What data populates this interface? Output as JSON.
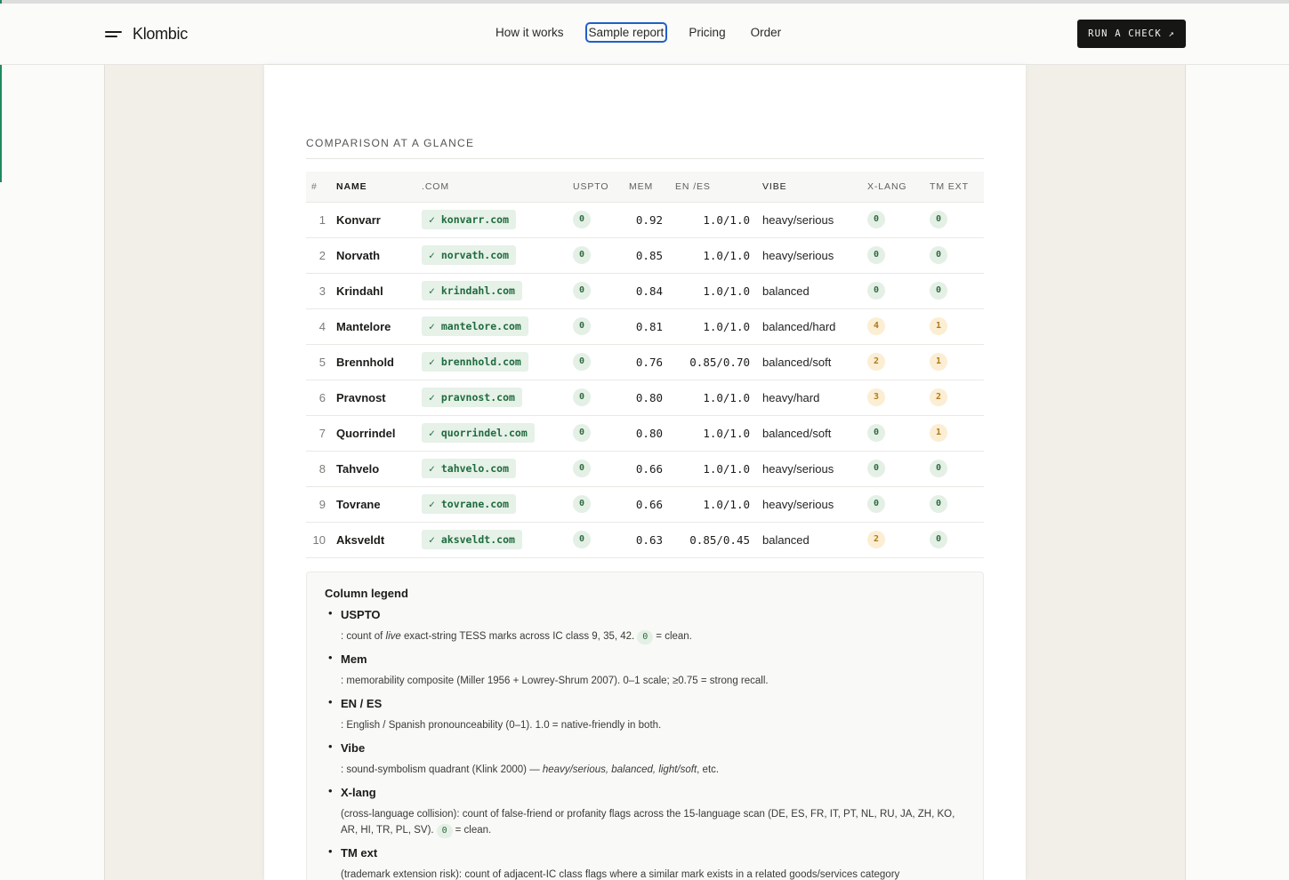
{
  "header": {
    "brand": "Klombic",
    "nav": [
      {
        "label": "How it works"
      },
      {
        "label": "Sample report"
      },
      {
        "label": "Pricing"
      },
      {
        "label": "Order"
      }
    ],
    "cta_label": "RUN A CHECK ↗"
  },
  "section": {
    "title": "COMPARISON AT A GLANCE"
  },
  "table": {
    "headers": {
      "num": "#",
      "name": "NAME",
      "dom": ".COM",
      "uspto": "USPTO",
      "mem": "MEM",
      "enes": "EN /ES",
      "vibe": "VIBE",
      "xlang": "X-LANG",
      "tmext": "TM EXT"
    },
    "rows": [
      {
        "num": "1",
        "name": "Konvarr",
        "dom": "✓ konvarr.com",
        "uspto": "0",
        "mem": "0.92",
        "enes": "1.0/1.0",
        "vibe": "heavy/serious",
        "xlang": "0",
        "tmext": "0"
      },
      {
        "num": "2",
        "name": "Norvath",
        "dom": "✓ norvath.com",
        "uspto": "0",
        "mem": "0.85",
        "enes": "1.0/1.0",
        "vibe": "heavy/serious",
        "xlang": "0",
        "tmext": "0"
      },
      {
        "num": "3",
        "name": "Krindahl",
        "dom": "✓ krindahl.com",
        "uspto": "0",
        "mem": "0.84",
        "enes": "1.0/1.0",
        "vibe": "balanced",
        "xlang": "0",
        "tmext": "0"
      },
      {
        "num": "4",
        "name": "Mantelore",
        "dom": "✓ mantelore.com",
        "uspto": "0",
        "mem": "0.81",
        "enes": "1.0/1.0",
        "vibe": "balanced/hard",
        "xlang": "4",
        "tmext": "1"
      },
      {
        "num": "5",
        "name": "Brennhold",
        "dom": "✓ brennhold.com",
        "uspto": "0",
        "mem": "0.76",
        "enes": "0.85/0.70",
        "vibe": "balanced/soft",
        "xlang": "2",
        "tmext": "1"
      },
      {
        "num": "6",
        "name": "Pravnost",
        "dom": "✓ pravnost.com",
        "uspto": "0",
        "mem": "0.80",
        "enes": "1.0/1.0",
        "vibe": "heavy/hard",
        "xlang": "3",
        "tmext": "2"
      },
      {
        "num": "7",
        "name": "Quorrindel",
        "dom": "✓ quorrindel.com",
        "uspto": "0",
        "mem": "0.80",
        "enes": "1.0/1.0",
        "vibe": "balanced/soft",
        "xlang": "0",
        "tmext": "1"
      },
      {
        "num": "8",
        "name": "Tahvelo",
        "dom": "✓ tahvelo.com",
        "uspto": "0",
        "mem": "0.66",
        "enes": "1.0/1.0",
        "vibe": "heavy/serious",
        "xlang": "0",
        "tmext": "0"
      },
      {
        "num": "9",
        "name": "Tovrane",
        "dom": "✓ tovrane.com",
        "uspto": "0",
        "mem": "0.66",
        "enes": "1.0/1.0",
        "vibe": "heavy/serious",
        "xlang": "0",
        "tmext": "0"
      },
      {
        "num": "10",
        "name": "Aksveldt",
        "dom": "✓ aksveldt.com",
        "uspto": "0",
        "mem": "0.63",
        "enes": "0.85/0.45",
        "vibe": "balanced",
        "xlang": "2",
        "tmext": "0"
      }
    ]
  },
  "legend": {
    "title": "Column legend",
    "items": [
      {
        "term": "USPTO",
        "desc_a": ": count of ",
        "desc_em": "live",
        "desc_b": " exact-string TESS marks across IC class 9, 35, 42.",
        "badge": "0",
        "desc_c": "= clean."
      },
      {
        "term": "Mem",
        "desc": ": memorability composite (Miller 1956 + Lowrey-Shrum 2007). 0–1 scale; ≥0.75 = strong recall."
      },
      {
        "term": "EN / ES",
        "desc": ": English / Spanish pronounceability (0–1). 1.0 = native-friendly in both."
      },
      {
        "term": "Vibe",
        "desc_a": ": sound-symbolism quadrant (Klink 2000) — ",
        "desc_em": "heavy/serious, balanced, light/soft",
        "desc_b": ", etc."
      },
      {
        "term": "X-lang",
        "desc_a": "(cross-language collision): count of false-friend or profanity flags across the 15-language scan (DE, ES, FR, IT, PT, NL, RU, JA, ZH, KO, AR, HI, TR, PL, SV).",
        "badge": "0",
        "desc_c": "= clean."
      },
      {
        "term": "TM ext",
        "desc": "(trademark extension risk): count of adjacent-IC class flags where a similar mark exists in a related goods/services category"
      }
    ]
  }
}
